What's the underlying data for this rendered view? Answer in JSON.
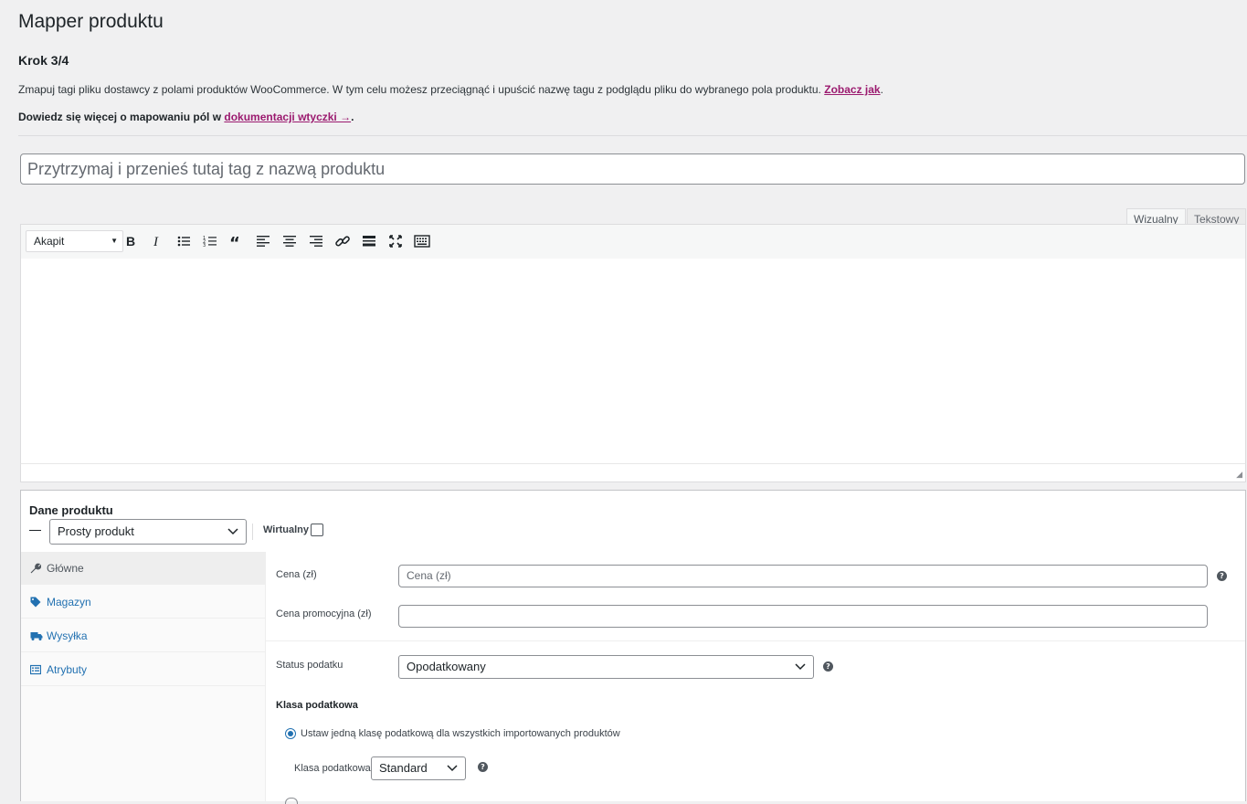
{
  "header": {
    "title": "Mapper produktu",
    "step": "Krok 3/4",
    "intro_text": "Zmapuj tagi pliku dostawcy z polami produktów WooCommerce. W tym celu możesz przeciągnąć i upuścić nazwę tagu z podglądu pliku do wybranego pola produktu.",
    "intro_link": "Zobacz jak",
    "intro_end": ".",
    "docs_text": "Dowiedz się więcej o mapowaniu pól w",
    "docs_link": "dokumentacji wtyczki →",
    "docs_end": "."
  },
  "title_field": {
    "placeholder": "Przytrzymaj i przenieś tutaj tag z nazwą produktu"
  },
  "editor": {
    "tabs": {
      "visual": "Wizualny",
      "text": "Tekstowy"
    },
    "format": "Akapit",
    "toolbar_icons": [
      "bold-icon",
      "italic-icon",
      "bullet-list-icon",
      "numbered-list-icon",
      "blockquote-icon",
      "align-left-icon",
      "align-center-icon",
      "align-right-icon",
      "link-icon",
      "read-more-icon",
      "fullscreen-icon",
      "toolbar-toggle-icon"
    ]
  },
  "product_data": {
    "title": "Dane produktu",
    "type_selected": "Prosty produkt",
    "virtual_label": "Wirtualny",
    "virtual_checked": false,
    "tabs": [
      {
        "label": "Główne",
        "icon": "wrench-icon",
        "active": true
      },
      {
        "label": "Magazyn",
        "icon": "tag-icon",
        "active": false
      },
      {
        "label": "Wysyłka",
        "icon": "truck-icon",
        "active": false
      },
      {
        "label": "Atrybuty",
        "icon": "list-icon",
        "active": false
      }
    ],
    "general": {
      "price_label": "Cena (zł)",
      "price_placeholder": "Cena (zł)",
      "sale_label": "Cena promocyjna (zł)",
      "sale_value": "",
      "tax_status_label": "Status podatku",
      "tax_status_value": "Opodatkowany",
      "tax_class_heading": "Klasa podatkowa",
      "tax_class_radio_label": "Ustaw jedną klasę podatkową dla wszystkich importowanych produktów",
      "tax_class_label": "Klasa podatkowa",
      "tax_class_value": "Standard"
    }
  }
}
